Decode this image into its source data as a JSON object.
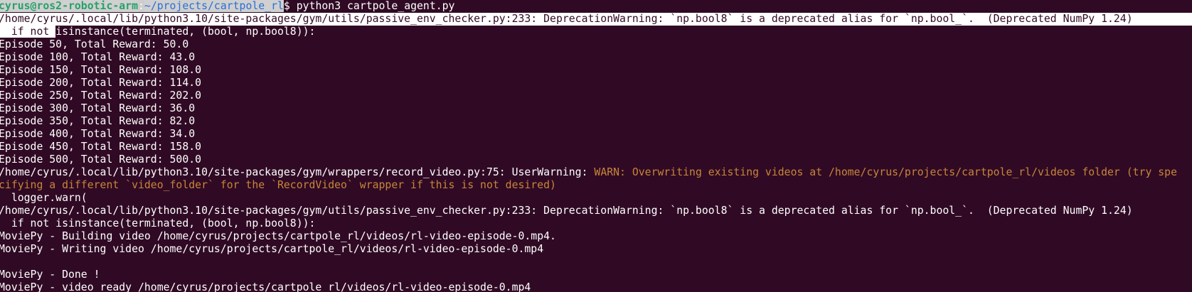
{
  "terminal": {
    "prompt": {
      "user_host": "cyrus@ros2-robotic-arm",
      "colon": ":",
      "path_selected": "~/projects/cartpole_rl",
      "dollar": "$ ",
      "command": "python3 cartpole_agent.py"
    },
    "deprecation_line_1": "/home/cyrus/.local/lib/python3.10/site-packages/gym/utils/passive_env_checker.py:233: DeprecationWarning: `np.bool8` is a deprecated alias for `np.bool_`.  (Deprecated NumPy 1.24)",
    "isinstance_line_1": {
      "selected": "  if not ",
      "rest": "isinstance(terminated, (bool, np.bool8)):"
    },
    "episodes": [
      "Episode 50, Total Reward: 50.0",
      "Episode 100, Total Reward: 43.0",
      "Episode 150, Total Reward: 108.0",
      "Episode 200, Total Reward: 114.0",
      "Episode 250, Total Reward: 202.0",
      "Episode 300, Total Reward: 36.0",
      "Episode 350, Total Reward: 82.0",
      "Episode 400, Total Reward: 34.0",
      "Episode 450, Total Reward: 158.0",
      "Episode 500, Total Reward: 500.0"
    ],
    "user_warning": {
      "prefix": "/home/cyrus/.local/lib/python3.10/site-packages/gym/wrappers/record_video.py:75: UserWarning: ",
      "warn_text_1": "WARN: Overwriting existing videos at /home/cyrus/projects/cartpole_rl/videos folder (try spe",
      "warn_text_2": "cifying a different `video_folder` for the `RecordVideo` wrapper if this is not desired)"
    },
    "logger_line": "  logger.warn(",
    "deprecation_line_2": "/home/cyrus/.local/lib/python3.10/site-packages/gym/utils/passive_env_checker.py:233: DeprecationWarning: `np.bool8` is a deprecated alias for `np.bool_`.  (Deprecated NumPy 1.24)",
    "isinstance_line_2": "  if not isinstance(terminated, (bool, np.bool8)):",
    "moviepy_building": "MoviePy - Building video /home/cyrus/projects/cartpole_rl/videos/rl-video-episode-0.mp4.",
    "moviepy_writing": "MoviePy - Writing video /home/cyrus/projects/cartpole_rl/videos/rl-video-episode-0.mp4",
    "moviepy_done": "MoviePy - Done !",
    "moviepy_ready": "MoviePy - video ready /home/cyrus/projects/cartpole_rl/videos/rl-video-episode-0.mp4"
  }
}
